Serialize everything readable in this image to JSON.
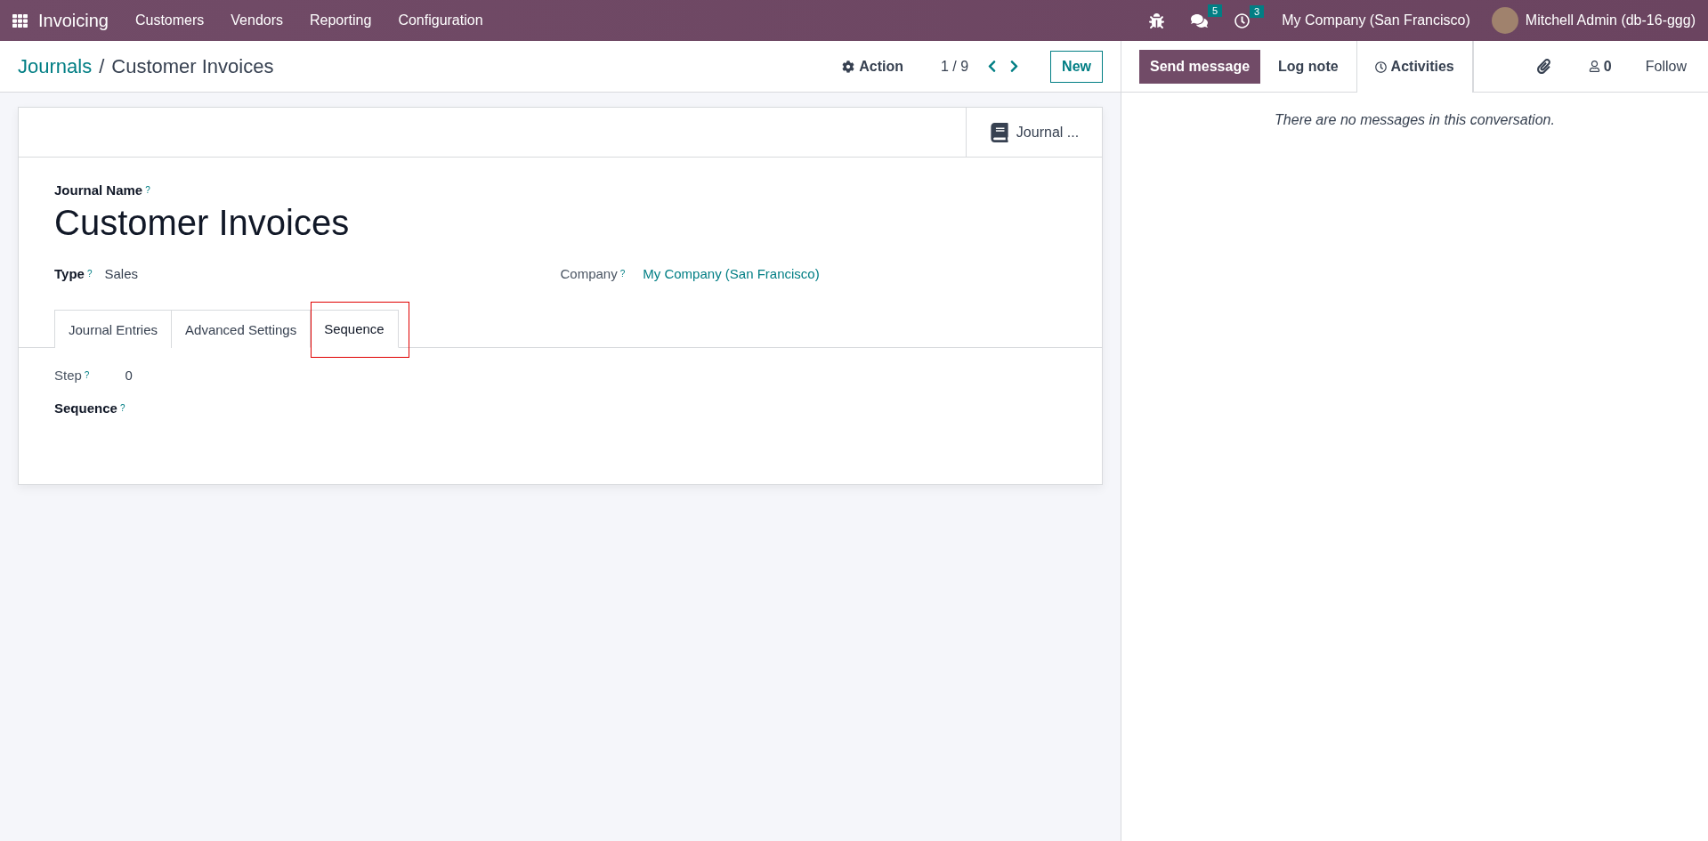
{
  "navbar": {
    "app": "Invoicing",
    "menu": [
      "Customers",
      "Vendors",
      "Reporting",
      "Configuration"
    ],
    "messages_badge": "5",
    "activities_badge": "3",
    "company": "My Company (San Francisco)",
    "user": "Mitchell Admin (db-16-ggg)"
  },
  "control_panel": {
    "breadcrumb": "Journals",
    "separator": "/",
    "current": "Customer Invoices",
    "action": "Action",
    "pager": "1 / 9",
    "new_button": "New"
  },
  "form": {
    "smart_button": "Journal ...",
    "name_label": "Journal Name",
    "help": "?",
    "name": "Customer Invoices",
    "fields": [
      {
        "label": "Type",
        "value": "Sales",
        "kind": "text"
      },
      {
        "label": "Company",
        "value": "My Company (San Francisco)",
        "kind": "link"
      }
    ],
    "tabs": [
      {
        "label": "Journal Entries",
        "selected": false,
        "highlighted": false
      },
      {
        "label": "Advanced Settings",
        "selected": false,
        "highlighted": false
      },
      {
        "label": "Sequence",
        "selected": true,
        "highlighted": true
      }
    ],
    "tab_fields": [
      {
        "label": "Step",
        "value": "0",
        "bold": false
      },
      {
        "label": "Sequence",
        "bold": true
      }
    ]
  },
  "chatter": {
    "send": "Send message",
    "log": "Log note",
    "activities": "Activities",
    "followers": "0",
    "follow": "Follow",
    "empty": "There are no messages in this conversation."
  }
}
